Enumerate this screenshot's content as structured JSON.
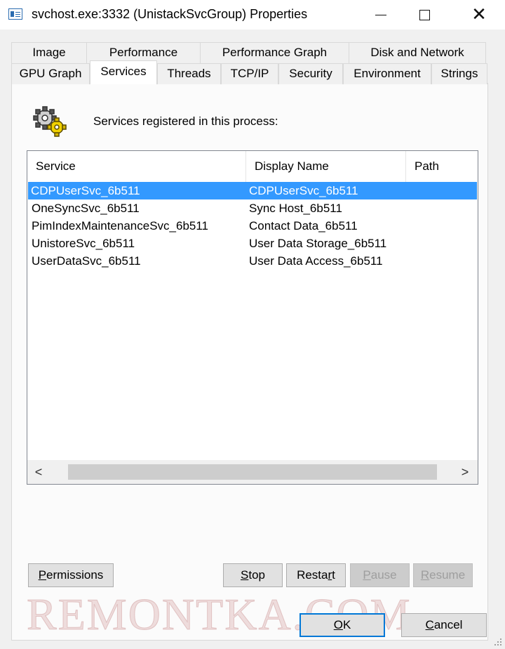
{
  "window": {
    "title": "svchost.exe:3332 (UnistackSvcGroup) Properties",
    "minimize_glyph": "",
    "maximize_glyph": "",
    "close_glyph": "✕"
  },
  "tabs": {
    "row1": [
      "Image",
      "Performance",
      "Performance Graph",
      "Disk and Network"
    ],
    "row2": [
      "GPU Graph",
      "Services",
      "Threads",
      "TCP/IP",
      "Security",
      "Environment",
      "Strings"
    ],
    "active": "Services"
  },
  "services_panel": {
    "caption": "Services registered in this process:",
    "columns": [
      "Service",
      "Display Name",
      "Path"
    ],
    "rows": [
      {
        "service": "CDPUserSvc_6b511",
        "display_name": "CDPUserSvc_6b511",
        "path": "",
        "selected": true
      },
      {
        "service": "OneSyncSvc_6b511",
        "display_name": "Sync Host_6b511",
        "path": ""
      },
      {
        "service": "PimIndexMaintenanceSvc_6b511",
        "display_name": "Contact Data_6b511",
        "path": ""
      },
      {
        "service": "UnistoreSvc_6b511",
        "display_name": "User Data Storage_6b511",
        "path": ""
      },
      {
        "service": "UserDataSvc_6b511",
        "display_name": "User Data Access_6b511",
        "path": ""
      }
    ],
    "scroll_left": "<",
    "scroll_right": ">"
  },
  "buttons": {
    "permissions": {
      "accel": "P",
      "rest": "ermissions"
    },
    "stop": {
      "accel": "S",
      "rest": "top"
    },
    "restart": {
      "pre": "Resta",
      "accel": "r",
      "rest": "t"
    },
    "pause": {
      "accel": "P",
      "rest": "ause"
    },
    "resume": {
      "accel": "R",
      "rest": "esume"
    },
    "ok": {
      "accel": "O",
      "rest": "K"
    },
    "cancel": {
      "accel": "C",
      "rest": "ancel"
    }
  },
  "watermark": "REMONTKA.COM",
  "colors": {
    "selection": "#3399ff",
    "default_button_border": "#0078d7",
    "dialog_background": "#f0f0f0"
  },
  "icons": {
    "app": "window-properties-icon",
    "services": "gears-icon"
  }
}
